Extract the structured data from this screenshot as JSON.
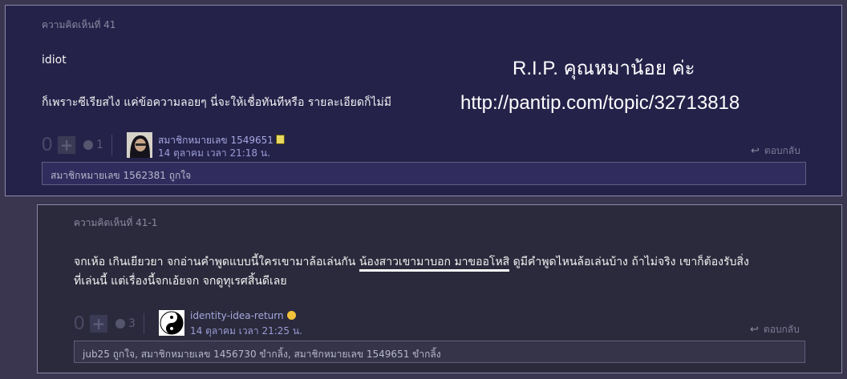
{
  "comment41": {
    "label": "ความคิดเห็นที่ 41",
    "line1": "idiot",
    "line2": "ก็เพราะซีเรียสไง แค่ข้อความลอยๆ นี่จะให้เชื่อทันทีหรือ รายละเอียดก็ไม่มี",
    "overlay_title": "R.I.P. คุณหมาน้อย ค่ะ",
    "overlay_url": "http://pantip.com/topic/32713818",
    "vote_count": "0",
    "emotion_count": "1",
    "username": "สมาชิกหมายเลข 1549651",
    "date": "14 ตุลาคม เวลา 21:18 น.",
    "reply_label": "ตอบกลับ",
    "likes": "สมาชิกหมายเลข 1562381 ถูกใจ"
  },
  "comment41_1": {
    "label": "ความคิดเห็นที่ 41-1",
    "line1_a": "จกเห้อ เกินเยียวยา จกอ่านคำพูดแบบนี้ใครเขามาล้อเล่นกัน ",
    "line1_underlined": "น้องสาวเขามาบอก มาขออโหสิ",
    "line1_b": " ดูมีคำพูดไหนล้อเล่นบ้าง ถ้าไม่จริง เขาก็ต้องรับสิ่ง",
    "line2": "ที่เล่นนี้ แต่เรื่องนี้จกเอ้ยจก  จกดูทุเรศสิ้นดีเลย",
    "vote_count": "0",
    "emotion_count": "3",
    "username": "identity-idea-return",
    "date": "14 ตุลาคม เวลา 21:25 น.",
    "reply_label": "ตอบกลับ",
    "likes": "jub25 ถูกใจ, สมาชิกหมายเลข 1456730 ขำกลิ้ง, สมาชิกหมายเลข 1549651 ขำกลิ้ง"
  },
  "colors": {
    "page_bg": "#3a3650",
    "comment_bg": "#25224a",
    "reply_bg": "#2b2a3c",
    "username": "#a6a8e0",
    "underline": "#ffffff"
  }
}
